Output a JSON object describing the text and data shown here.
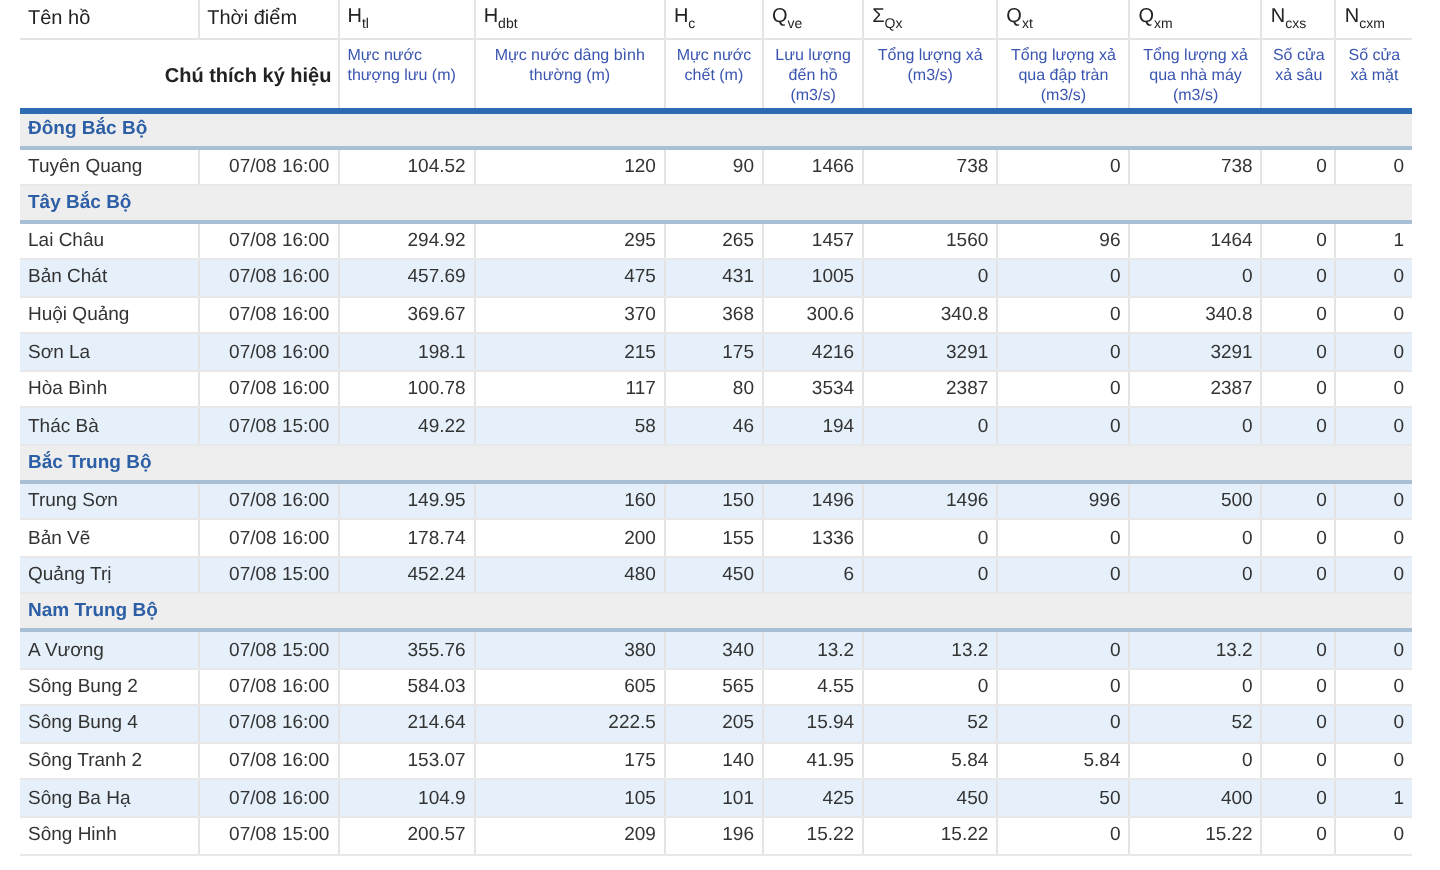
{
  "legend_label": "Chú thích ký hiệu",
  "columns": [
    {
      "symbol": "Tên hồ"
    },
    {
      "symbol": "Thời điểm"
    },
    {
      "symbol": "H$_{tl}$",
      "description": "Mực nước thượng lưu (m)"
    },
    {
      "symbol": "H$_{dbt}$",
      "description": "Mực nước dâng bình thường (m)"
    },
    {
      "symbol": "H$_{c}$",
      "description": "Mực nước chết (m)"
    },
    {
      "symbol": "Q$_{ve}$",
      "description": "Lưu lượng đến hồ (m3/s)"
    },
    {
      "symbol": "Σ$_{Qx}$",
      "description": "Tổng lượng xả (m3/s)"
    },
    {
      "symbol": "Q$_{xt}$",
      "description": "Tổng lượng xả qua đập tràn (m3/s)"
    },
    {
      "symbol": "Q$_{xm}$",
      "description": "Tổng lượng xả qua nhà máy (m3/s)"
    },
    {
      "symbol": "N$_{cxs}$",
      "description": "Số cửa xả sâu"
    },
    {
      "symbol": "N$_{cxm}$",
      "description": "Số cửa xả mặt"
    }
  ],
  "groups": [
    {
      "name": "Đông Bắc Bộ",
      "rows": [
        {
          "highlighted": false,
          "cells": [
            "Tuyên Quang",
            "07/08 16:00",
            "104.52",
            "120",
            "90",
            "1466",
            "738",
            "0",
            "738",
            "0",
            "0"
          ]
        }
      ]
    },
    {
      "name": "Tây Bắc Bộ",
      "rows": [
        {
          "highlighted": false,
          "cells": [
            "Lai Châu",
            "07/08 16:00",
            "294.92",
            "295",
            "265",
            "1457",
            "1560",
            "96",
            "1464",
            "0",
            "1"
          ]
        },
        {
          "highlighted": true,
          "cells": [
            "Bản Chát",
            "07/08 16:00",
            "457.69",
            "475",
            "431",
            "1005",
            "0",
            "0",
            "0",
            "0",
            "0"
          ]
        },
        {
          "highlighted": false,
          "cells": [
            "Huội Quảng",
            "07/08 16:00",
            "369.67",
            "370",
            "368",
            "300.6",
            "340.8",
            "0",
            "340.8",
            "0",
            "0"
          ]
        },
        {
          "highlighted": true,
          "cells": [
            "Sơn La",
            "07/08 16:00",
            "198.1",
            "215",
            "175",
            "4216",
            "3291",
            "0",
            "3291",
            "0",
            "0"
          ]
        },
        {
          "highlighted": false,
          "cells": [
            "Hòa Bình",
            "07/08 16:00",
            "100.78",
            "117",
            "80",
            "3534",
            "2387",
            "0",
            "2387",
            "0",
            "0"
          ]
        },
        {
          "highlighted": true,
          "cells": [
            "Thác Bà",
            "07/08 15:00",
            "49.22",
            "58",
            "46",
            "194",
            "0",
            "0",
            "0",
            "0",
            "0"
          ]
        }
      ]
    },
    {
      "name": "Bắc Trung Bộ",
      "rows": [
        {
          "highlighted": true,
          "cells": [
            "Trung Sơn",
            "07/08 16:00",
            "149.95",
            "160",
            "150",
            "1496",
            "1496",
            "996",
            "500",
            "0",
            "0"
          ]
        },
        {
          "highlighted": false,
          "cells": [
            "Bản Vẽ",
            "07/08 16:00",
            "178.74",
            "200",
            "155",
            "1336",
            "0",
            "0",
            "0",
            "0",
            "0"
          ]
        },
        {
          "highlighted": true,
          "cells": [
            "Quảng Trị",
            "07/08 15:00",
            "452.24",
            "480",
            "450",
            "6",
            "0",
            "0",
            "0",
            "0",
            "0"
          ]
        }
      ]
    },
    {
      "name": "Nam Trung Bộ",
      "rows": [
        {
          "highlighted": true,
          "cells": [
            "A Vương",
            "07/08 15:00",
            "355.76",
            "380",
            "340",
            "13.2",
            "13.2",
            "0",
            "13.2",
            "0",
            "0"
          ]
        },
        {
          "highlighted": false,
          "cells": [
            "Sông Bung 2",
            "07/08 16:00",
            "584.03",
            "605",
            "565",
            "4.55",
            "0",
            "0",
            "0",
            "0",
            "0"
          ]
        },
        {
          "highlighted": true,
          "cells": [
            "Sông Bung 4",
            "07/08 16:00",
            "214.64",
            "222.5",
            "205",
            "15.94",
            "52",
            "0",
            "52",
            "0",
            "0"
          ]
        },
        {
          "highlighted": false,
          "cells": [
            "Sông Tranh 2",
            "07/08 16:00",
            "153.07",
            "175",
            "140",
            "41.95",
            "5.84",
            "5.84",
            "0",
            "0",
            "0"
          ]
        },
        {
          "highlighted": true,
          "cells": [
            "Sông Ba Hạ",
            "07/08 16:00",
            "104.9",
            "105",
            "101",
            "425",
            "450",
            "50",
            "400",
            "0",
            "1"
          ]
        },
        {
          "highlighted": false,
          "cells": [
            "Sông Hinh",
            "07/08 15:00",
            "200.57",
            "209",
            "196",
            "15.22",
            "15.22",
            "0",
            "15.22",
            "0",
            "0"
          ]
        }
      ]
    }
  ]
}
